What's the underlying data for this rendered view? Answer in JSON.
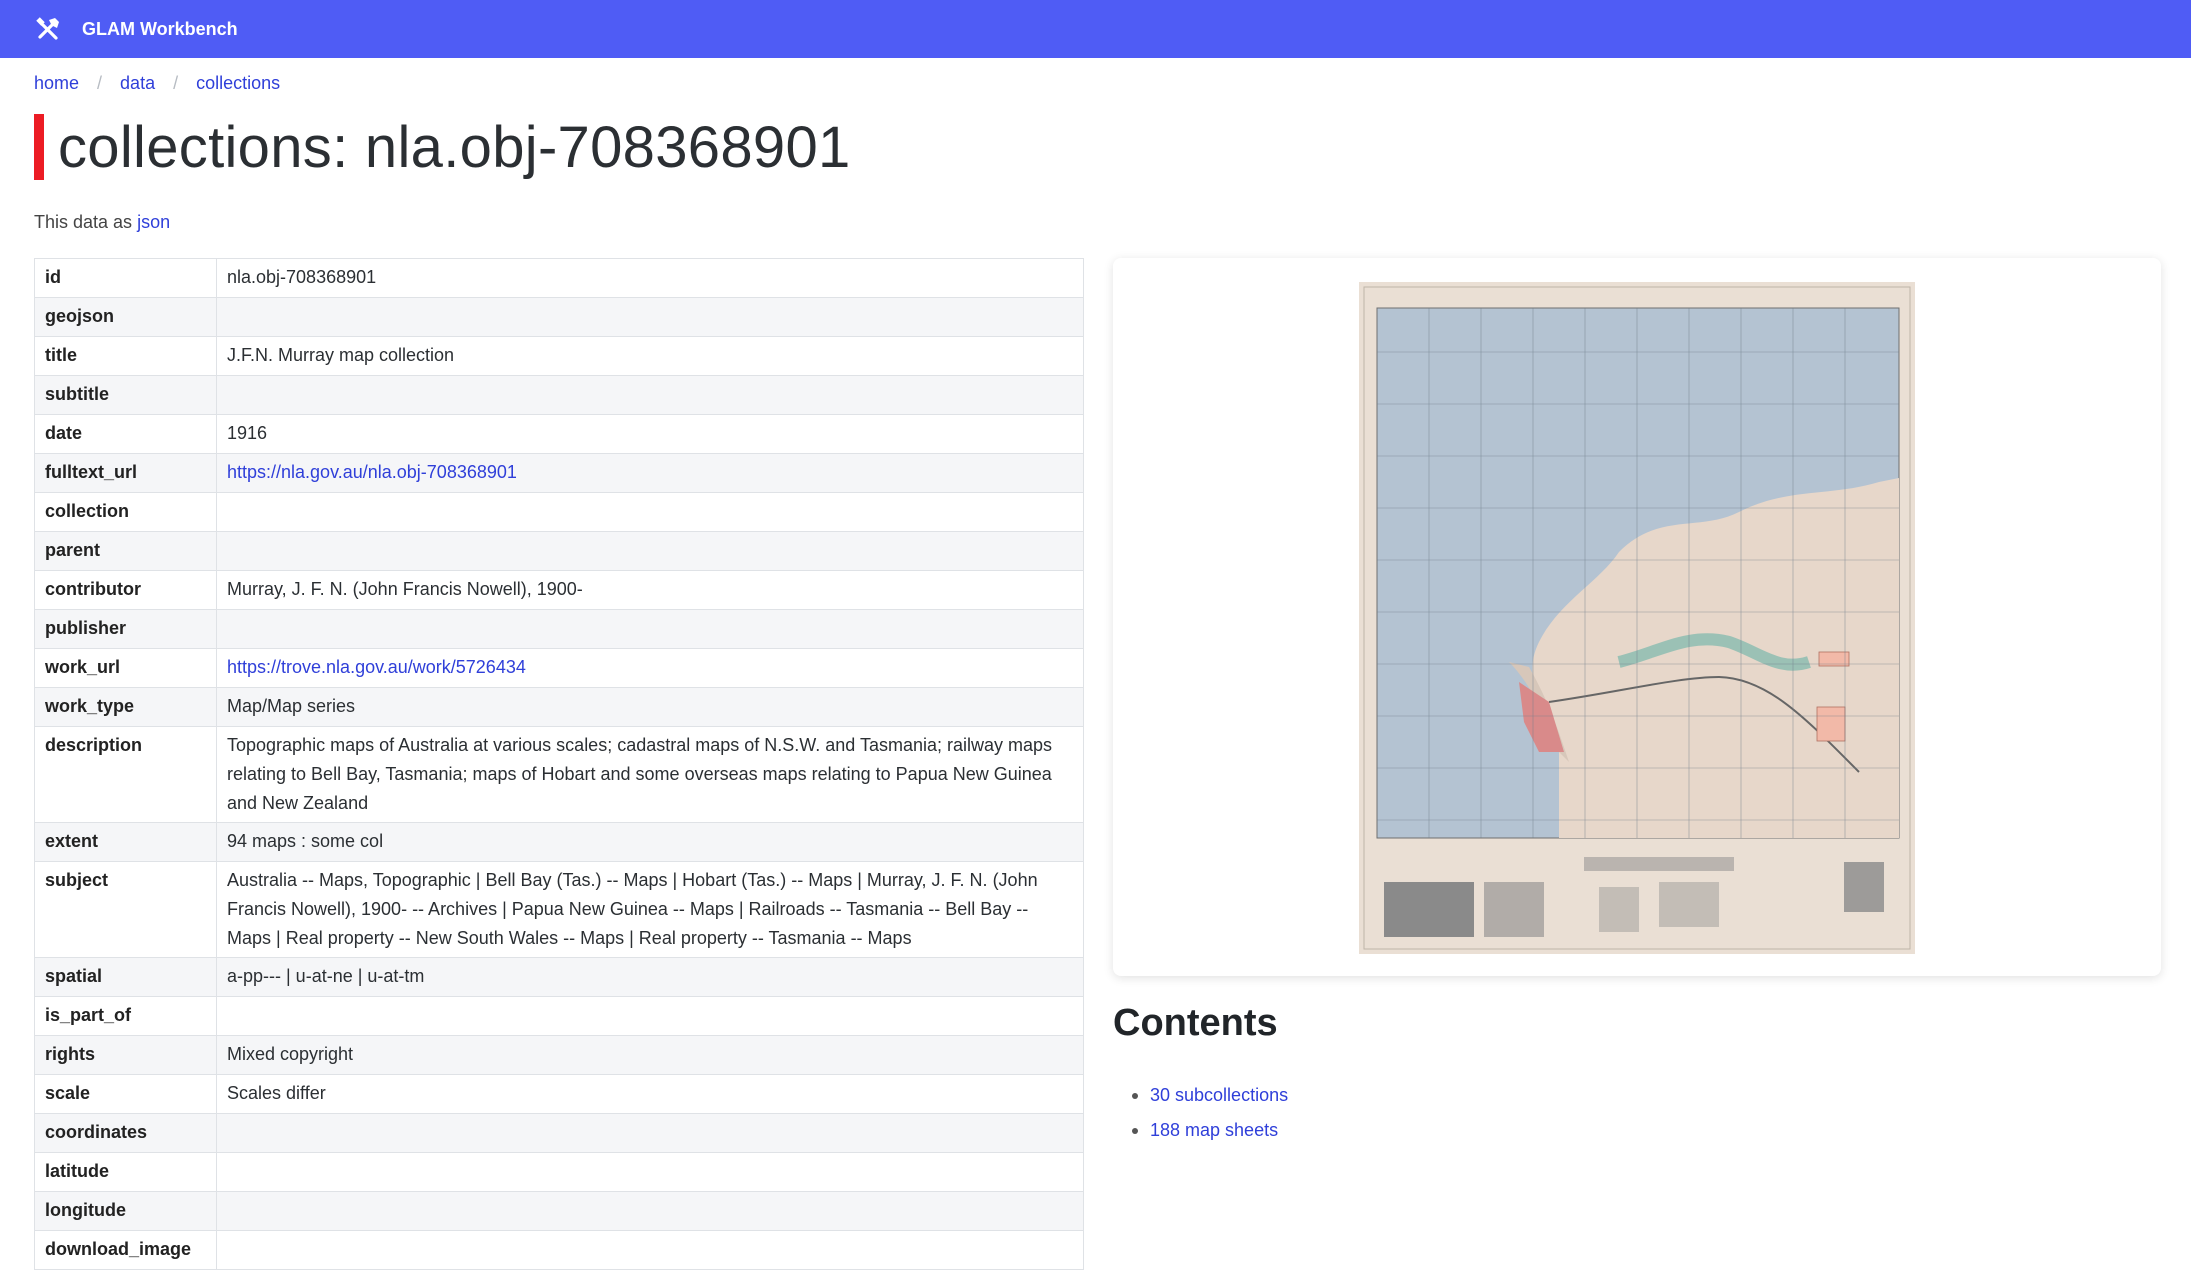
{
  "header": {
    "brand": "GLAM Workbench",
    "icon": "tools-icon",
    "color": "#4f5cf5"
  },
  "breadcrumb": [
    {
      "label": "home"
    },
    {
      "label": "data"
    },
    {
      "label": "collections"
    }
  ],
  "page": {
    "title": "collections: nla.obj-708368901",
    "json_prefix": "This data as",
    "json_link": "json"
  },
  "fields": [
    {
      "key": "id",
      "value": "nla.obj-708368901"
    },
    {
      "key": "geojson",
      "value": ""
    },
    {
      "key": "title",
      "value": "J.F.N. Murray map collection"
    },
    {
      "key": "subtitle",
      "value": ""
    },
    {
      "key": "date",
      "value": "1916"
    },
    {
      "key": "fulltext_url",
      "value": "https://nla.gov.au/nla.obj-708368901",
      "link": true
    },
    {
      "key": "collection",
      "value": ""
    },
    {
      "key": "parent",
      "value": ""
    },
    {
      "key": "contributor",
      "value": "Murray, J. F. N. (John Francis Nowell), 1900-"
    },
    {
      "key": "publisher",
      "value": ""
    },
    {
      "key": "work_url",
      "value": "https://trove.nla.gov.au/work/5726434",
      "link": true
    },
    {
      "key": "work_type",
      "value": "Map/Map series"
    },
    {
      "key": "description",
      "value": "Topographic maps of Australia at various scales; cadastral maps of N.S.W. and Tasmania; railway maps relating to Bell Bay, Tasmania; maps of Hobart and some overseas maps relating to Papua New Guinea and New Zealand"
    },
    {
      "key": "extent",
      "value": "94 maps : some col"
    },
    {
      "key": "subject",
      "value": "Australia -- Maps, Topographic | Bell Bay (Tas.) -- Maps | Hobart (Tas.) -- Maps | Murray, J. F. N. (John Francis Nowell), 1900- -- Archives | Papua New Guinea -- Maps | Railroads -- Tasmania -- Bell Bay -- Maps | Real property -- New South Wales -- Maps | Real property -- Tasmania -- Maps"
    },
    {
      "key": "spatial",
      "value": "a-pp--- | u-at-ne | u-at-tm"
    },
    {
      "key": "is_part_of",
      "value": ""
    },
    {
      "key": "rights",
      "value": "Mixed copyright"
    },
    {
      "key": "scale",
      "value": "Scales differ"
    },
    {
      "key": "coordinates",
      "value": ""
    },
    {
      "key": "latitude",
      "value": ""
    },
    {
      "key": "longitude",
      "value": ""
    },
    {
      "key": "download_image",
      "value": ""
    }
  ],
  "contents": {
    "heading": "Contents",
    "items": [
      {
        "label": "30 subcollections"
      },
      {
        "label": "188 map sheets"
      }
    ]
  }
}
